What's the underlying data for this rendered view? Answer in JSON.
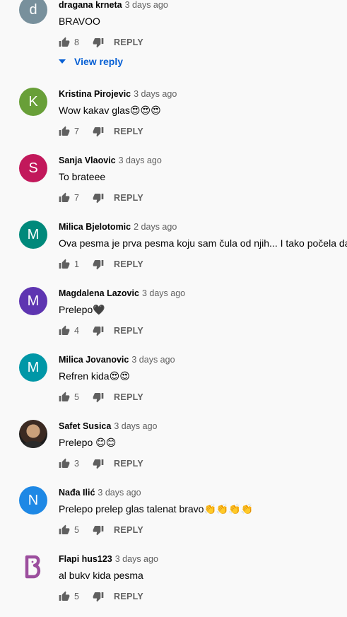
{
  "accent": "#065fd4",
  "comments": [
    {
      "author": "dragana krneta",
      "time": "3 days ago",
      "text": "BRAVOO",
      "likes": "8",
      "avatar_letter": "d",
      "avatar_color": "#78909c",
      "view_replies": "View reply"
    },
    {
      "author": "Kristina Pirojevic",
      "time": "3 days ago",
      "text": "Wow kakav glas😍😍😍",
      "likes": "7",
      "avatar_letter": "K",
      "avatar_color": "#689f38"
    },
    {
      "author": "Sanja Vlaovic",
      "time": "3 days ago",
      "text": "To brateee",
      "likes": "7",
      "avatar_letter": "S",
      "avatar_color": "#c2185b"
    },
    {
      "author": "Milica Bjelotomic",
      "time": "2 days ago",
      "text": "Ova pesma je prva pesma koju sam čula od njih... I tako počela da",
      "likes": "1",
      "avatar_letter": "M",
      "avatar_color": "#00897b"
    },
    {
      "author": "Magdalena Lazovic",
      "time": "3 days ago",
      "text": "Prelepo🖤",
      "likes": "4",
      "avatar_letter": "M",
      "avatar_color": "#5e35b1"
    },
    {
      "author": "Milica Jovanovic",
      "time": "3 days ago",
      "text": "Refren kida😍😍",
      "likes": "5",
      "avatar_letter": "M",
      "avatar_color": "#0097a7"
    },
    {
      "author": "Safet Susica",
      "time": "3 days ago",
      "text": "Prelepo 😊😊",
      "likes": "3",
      "avatar_type": "photo"
    },
    {
      "author": "Nađa Ilić",
      "time": "3 days ago",
      "text": "Prelepo prelep glas talenat bravo👏👏👏👏",
      "likes": "5",
      "avatar_letter": "N",
      "avatar_color": "#1e88e5"
    },
    {
      "author": "Flapi hus123",
      "time": "3 days ago",
      "text": "al bukv kida pesma",
      "likes": "5",
      "avatar_type": "logo"
    }
  ],
  "reply_label": "REPLY"
}
